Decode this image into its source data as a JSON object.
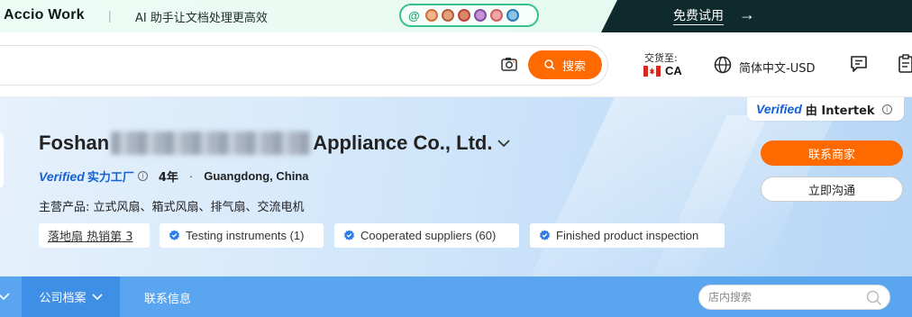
{
  "promo": {
    "logo": "Accio Work",
    "separator": "|",
    "tagline": "AI 助手让文档处理更高效",
    "pill_at": "@",
    "cta": "免费试用",
    "cta_arrow": "→",
    "avatar_colors": [
      "#f2b48a",
      "#e8a07a",
      "#d98863",
      "#c792d6",
      "#f0a6a6",
      "#88c3e8"
    ]
  },
  "header": {
    "search_button": "搜索",
    "ship_to_label": "交货至:",
    "ship_to_country": "CA",
    "language_currency": "简体中文-USD"
  },
  "company": {
    "verified_word": "Verified",
    "verified_by": "由 Intertek",
    "info": "i",
    "name_prefix": "Foshan",
    "name_suffix": "Appliance Co., Ltd.",
    "manufacturer": "实力工厂",
    "years": "4年",
    "dot": "·",
    "location": "Guangdong, China",
    "main_products": "主营产品: 立式风扇、箱式风扇、排气扇、交流电机",
    "tags": {
      "rank": "落地扇 热销第 3",
      "t1": "Testing instruments (1)",
      "t2": "Cooperated suppliers (60)",
      "t3": "Finished product inspection"
    },
    "contact_button": "联系商家",
    "chat_button": "立即沟通"
  },
  "nav": {
    "active_tab": "公司档案",
    "tab_contact": "联系信息",
    "store_search_placeholder": "店内搜索"
  },
  "colors": {
    "accent_orange": "#ff6a00",
    "verified_blue": "#1460d4",
    "nav_blue": "#5aa5f0",
    "nav_active_blue": "#3f8fe6",
    "promo_dark": "#0f2a2c"
  }
}
